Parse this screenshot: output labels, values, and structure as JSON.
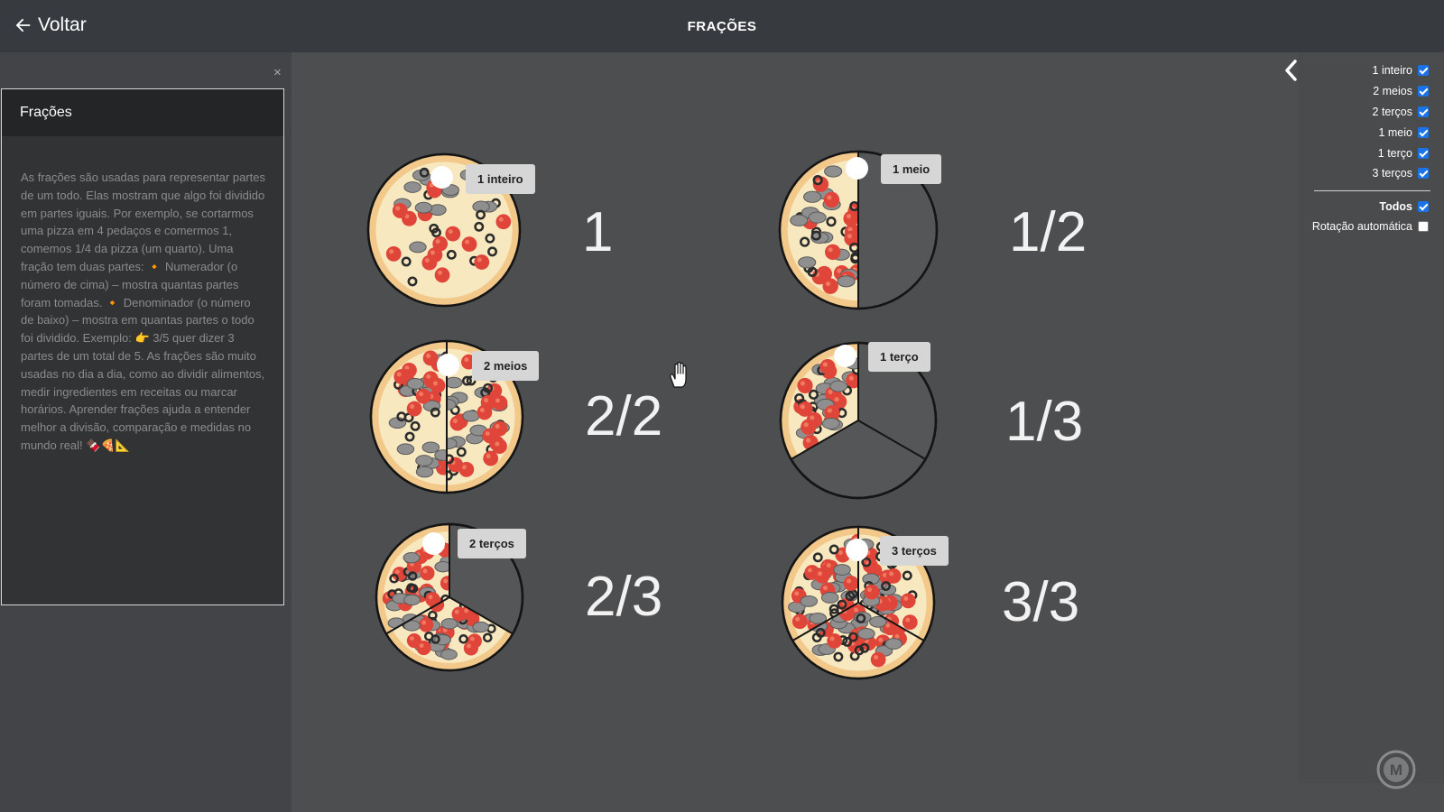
{
  "header": {
    "back_label": "Voltar",
    "title": "FRAÇÕES"
  },
  "info": {
    "title": "Frações",
    "text": "As frações são usadas para representar partes de um todo. Elas mostram que algo foi dividido em partes iguais. Por exemplo, se cortarmos uma pizza em 4 pedaços e comermos 1, comemos 1/4 da pizza (um quarto). Uma fração tem duas partes: 🔸 Numerador (o número de cima) – mostra quantas partes foram tomadas. 🔸 Denominador (o número de baixo) – mostra em quantas partes o todo foi dividido. Exemplo: 👉 3/5 quer dizer 3 partes de um total de 5. As frações são muito usadas no dia a dia, como ao dividir alimentos, medir ingredientes em receitas ou marcar horários. Aprender frações ajuda a entender melhor a divisão, comparação e medidas no mundo real! 🍫🍕📐"
  },
  "options": [
    {
      "label": "1 inteiro",
      "checked": true
    },
    {
      "label": "2 meios",
      "checked": true
    },
    {
      "label": "2 terços",
      "checked": true
    },
    {
      "label": "1 meio",
      "checked": true
    },
    {
      "label": "1 terço",
      "checked": true
    },
    {
      "label": "3 terços",
      "checked": true
    }
  ],
  "todos": {
    "label": "Todos",
    "checked": true
  },
  "autorotate": {
    "label": "Rotação automática",
    "checked": false
  },
  "pizzas": [
    {
      "label": "1 inteiro",
      "fraction": "1",
      "denominator": 1,
      "shown": 1
    },
    {
      "label": "1 meio",
      "fraction": "1/2",
      "denominator": 2,
      "shown": 1
    },
    {
      "label": "2 meios",
      "fraction": "2/2",
      "denominator": 2,
      "shown": 2
    },
    {
      "label": "1 terço",
      "fraction": "1/3",
      "denominator": 3,
      "shown": 1
    },
    {
      "label": "2 terços",
      "fraction": "2/3",
      "denominator": 3,
      "shown": 2
    },
    {
      "label": "3 terços",
      "fraction": "3/3",
      "denominator": 3,
      "shown": 3
    }
  ],
  "colors": {
    "topbar": "#373a3f",
    "canvas": "#4d4e50",
    "accent_checkbox": "#1a73e8",
    "label_bg": "#d6d6d6"
  },
  "icons": {
    "back": "arrow-left-icon",
    "close": "close-icon",
    "collapse": "chevron-left-icon",
    "cursor": "hand-cursor-icon",
    "logo": "m-logo-icon"
  }
}
